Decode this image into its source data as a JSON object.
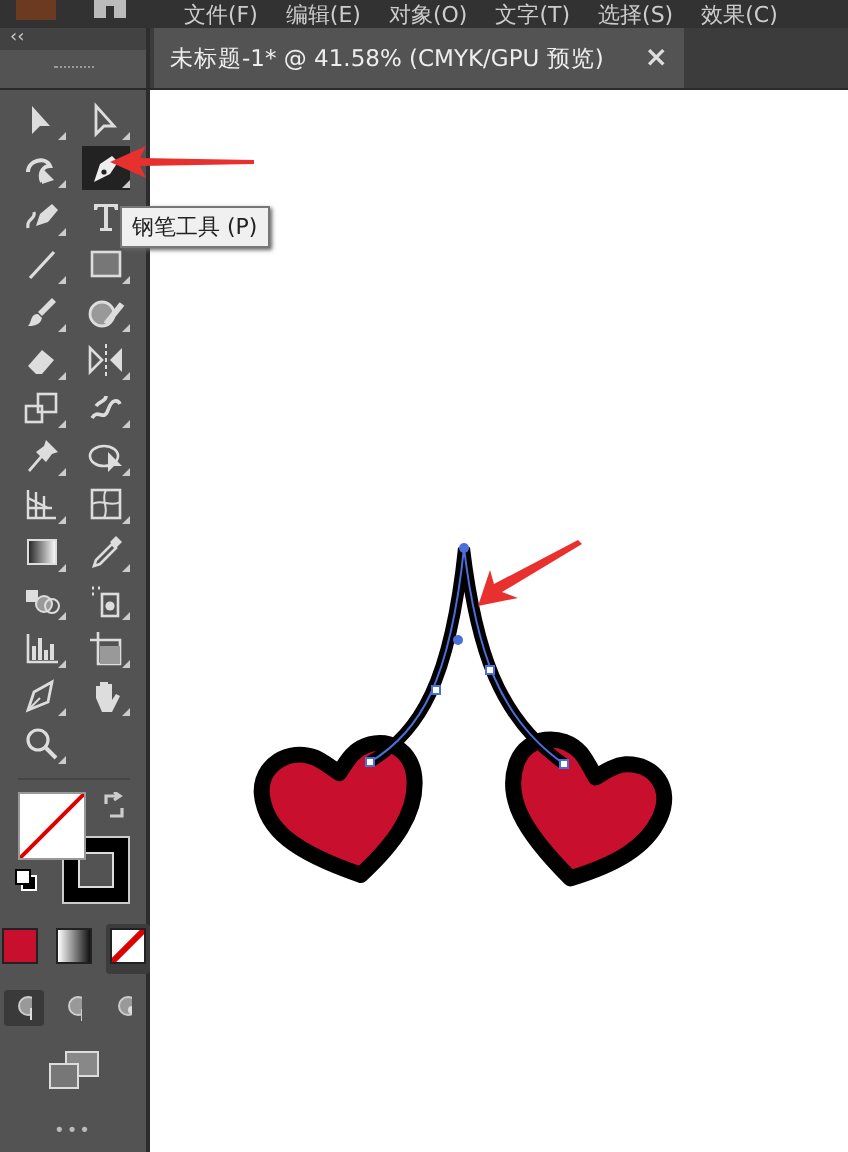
{
  "menu": [
    "文件(F)",
    "编辑(E)",
    "对象(O)",
    "文字(T)",
    "选择(S)",
    "效果(C)"
  ],
  "panel_collapse": "‹‹",
  "document_tab": {
    "title": "未标题-1* @ 41.58% (CMYK/GPU 预览)",
    "close": "×"
  },
  "tools": [
    {
      "kind": "selection",
      "selected": false
    },
    {
      "kind": "direct",
      "selected": false
    },
    {
      "kind": "curvature",
      "selected": false
    },
    {
      "kind": "pen",
      "selected": true
    },
    {
      "kind": "pencil",
      "selected": false
    },
    {
      "kind": "type",
      "selected": false
    },
    {
      "kind": "line",
      "selected": false
    },
    {
      "kind": "rectangle",
      "selected": false
    },
    {
      "kind": "brush",
      "selected": false
    },
    {
      "kind": "shaper",
      "selected": false
    },
    {
      "kind": "eraser",
      "selected": false
    },
    {
      "kind": "reflect",
      "selected": false
    },
    {
      "kind": "scale",
      "selected": false
    },
    {
      "kind": "warp",
      "selected": false
    },
    {
      "kind": "pin",
      "selected": false
    },
    {
      "kind": "puppet",
      "selected": false
    },
    {
      "kind": "perspective",
      "selected": false
    },
    {
      "kind": "mesh",
      "selected": false
    },
    {
      "kind": "gradient",
      "selected": false
    },
    {
      "kind": "eyedropper",
      "selected": false
    },
    {
      "kind": "blend",
      "selected": false
    },
    {
      "kind": "sprayer",
      "selected": false
    },
    {
      "kind": "graph",
      "selected": false
    },
    {
      "kind": "artboard",
      "selected": false
    },
    {
      "kind": "knife",
      "selected": false
    },
    {
      "kind": "hand",
      "selected": false
    },
    {
      "kind": "zoom",
      "selected": false
    }
  ],
  "tooltip": "钢笔工具 (P)",
  "color_modes": [
    {
      "kind": "color",
      "color": "#c8102e",
      "selected": false
    },
    {
      "kind": "gradient",
      "selected": false
    },
    {
      "kind": "none",
      "selected": true
    }
  ],
  "draw_modes": [
    {
      "selected": true
    },
    {
      "selected": false
    },
    {
      "selected": false
    }
  ],
  "more": "•••"
}
